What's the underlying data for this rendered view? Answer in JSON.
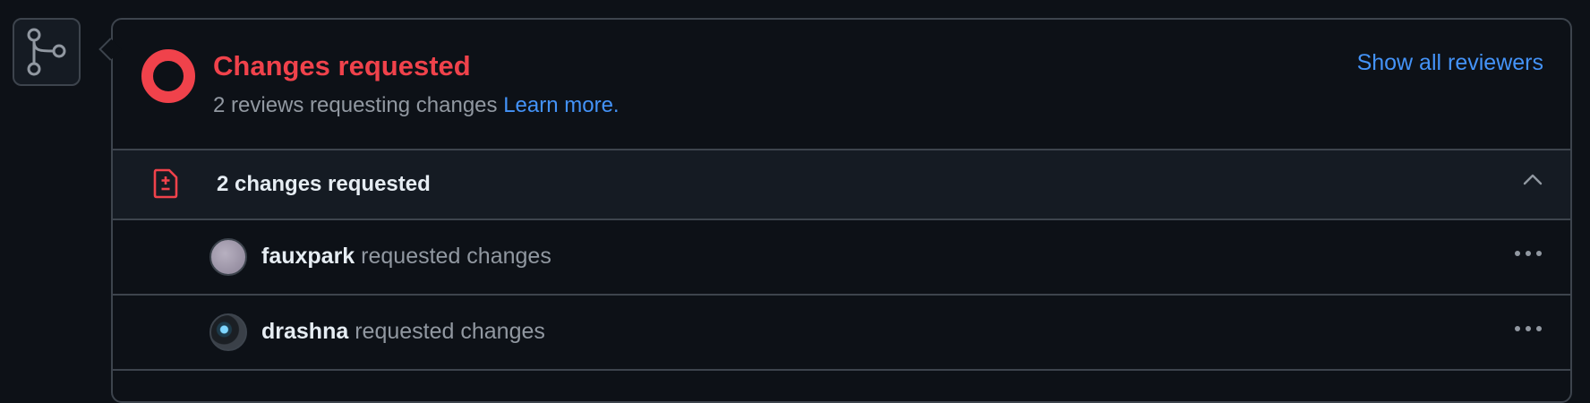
{
  "status": {
    "title": "Changes requested",
    "subtitle": "2 reviews requesting changes",
    "learn_more": "Learn more.",
    "show_all": "Show all reviewers"
  },
  "group": {
    "title": "2 changes requested",
    "icon": "file-diff-icon"
  },
  "reviews": [
    {
      "name": "fauxpark",
      "action": "requested changes"
    },
    {
      "name": "drashna",
      "action": "requested changes"
    }
  ],
  "colors": {
    "accent_red": "#f0424b",
    "link_blue": "#4493f8",
    "background": "#0d1117",
    "border": "#3d444d"
  }
}
